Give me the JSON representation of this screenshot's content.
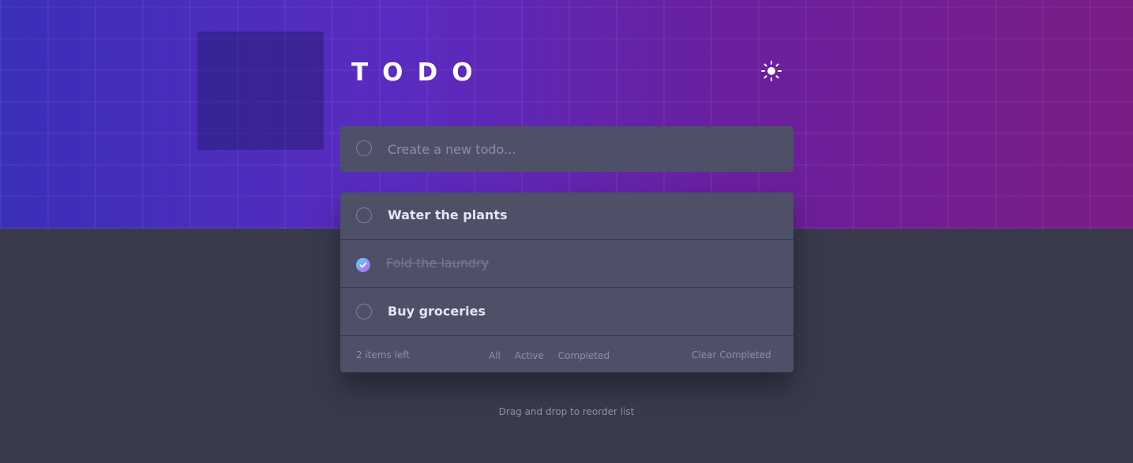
{
  "app": {
    "title": "TODO"
  },
  "new_todo": {
    "placeholder": "Create a new todo..."
  },
  "todos": [
    {
      "text": "Water the plants",
      "completed": false
    },
    {
      "text": "Fold the laundry",
      "completed": true
    },
    {
      "text": "Buy groceries",
      "completed": false
    }
  ],
  "footer": {
    "items_left": "2 items left",
    "filters": [
      "All",
      "Active",
      "Completed"
    ],
    "clear_label": "Clear Completed"
  },
  "hint": "Drag and drop to reorder list",
  "icons": {
    "theme_toggle": "sun-icon",
    "check": "check-icon"
  },
  "colors": {
    "hero_start": "#3a2fb8",
    "hero_end": "#7b1d86",
    "background": "#393a4c",
    "card": "#4d5066",
    "check_gradient_start": "#57ddff",
    "check_gradient_end": "#c058f3"
  }
}
